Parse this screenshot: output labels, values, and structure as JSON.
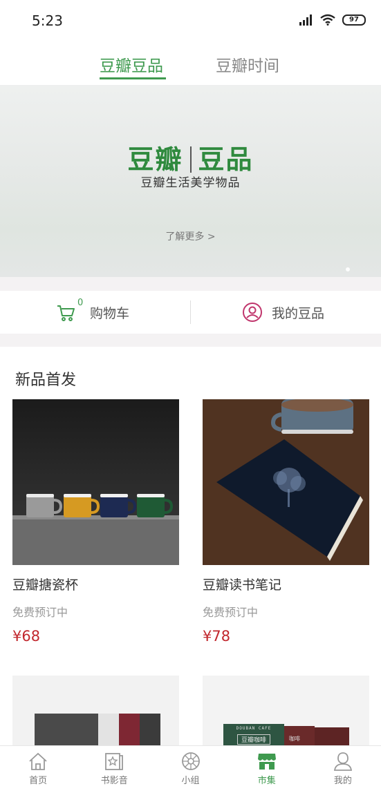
{
  "status_bar": {
    "time": "5:23",
    "battery": "97"
  },
  "top_tabs": [
    {
      "label": "豆瓣豆品",
      "active": true
    },
    {
      "label": "豆瓣时间",
      "active": false
    }
  ],
  "banner": {
    "logo_left": "豆瓣",
    "logo_right": "豆品",
    "subtitle": "豆瓣生活美学物品",
    "more": "了解更多 >"
  },
  "quick": {
    "cart_label": "购物车",
    "cart_count": "0",
    "my_label": "我的豆品"
  },
  "section": {
    "title": "新品首发",
    "products": [
      {
        "name": "豆瓣搪瓷杯",
        "status": "免费预订中",
        "price": "¥68"
      },
      {
        "name": "豆瓣读书笔记",
        "status": "免费预订中",
        "price": "¥78"
      }
    ],
    "second_row_labels": {
      "box_top": "DOUBAN CAFE",
      "box_name": "豆瓣咖啡",
      "box_small": "咖啡"
    }
  },
  "bottom_nav": [
    {
      "label": "首页",
      "icon": "home-icon",
      "active": false
    },
    {
      "label": "书影音",
      "icon": "media-icon",
      "active": false
    },
    {
      "label": "小组",
      "icon": "group-icon",
      "active": false
    },
    {
      "label": "市集",
      "icon": "market-icon",
      "active": true
    },
    {
      "label": "我的",
      "icon": "profile-icon",
      "active": false
    }
  ],
  "colors": {
    "accent": "#3f9a4f",
    "price": "#c1272d",
    "pink": "#c0356c"
  }
}
